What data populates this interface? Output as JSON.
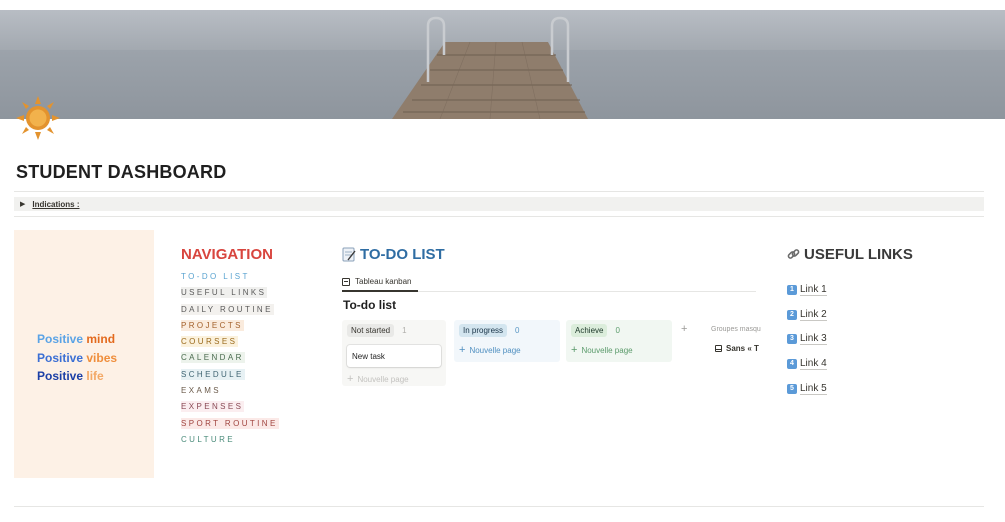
{
  "page": {
    "title": "STUDENT DASHBOARD",
    "page_icon": "sun-icon"
  },
  "toggle": {
    "label": "Indications :"
  },
  "vibes": [
    {
      "word": "Positive",
      "emphasis": "mind"
    },
    {
      "word": "Positive",
      "emphasis": "vibes"
    },
    {
      "word": "Positive",
      "emphasis": "life"
    }
  ],
  "navigation": {
    "title": "NAVIGATION",
    "items": [
      {
        "label": "TO-DO LIST",
        "color": "#5aa3d0",
        "bg": "transparent"
      },
      {
        "label": "USEFUL LINKS",
        "color": "#5a5a5a",
        "bg": "#f0f0ee"
      },
      {
        "label": "DAILY ROUTINE",
        "color": "#5a5a5a",
        "bg": "#f3f1ee"
      },
      {
        "label": "PROJECTS",
        "color": "#a3612c",
        "bg": "#faebdd"
      },
      {
        "label": "COURSES",
        "color": "#9a6a1c",
        "bg": "#fbf1dc"
      },
      {
        "label": "CALENDAR",
        "color": "#4a6b4f",
        "bg": "#edf3ec"
      },
      {
        "label": "SCHEDULE",
        "color": "#3f6472",
        "bg": "#e7f1f4"
      },
      {
        "label": "EXAMS",
        "color": "#6a5a4a",
        "bg": "transparent"
      },
      {
        "label": "EXPENSES",
        "color": "#8a4a55",
        "bg": "#fbeef0"
      },
      {
        "label": "SPORT ROUTINE",
        "color": "#a0443f",
        "bg": "#fbe9e7"
      },
      {
        "label": "CULTURE",
        "color": "#4a8b7a",
        "bg": "transparent"
      }
    ]
  },
  "todo": {
    "title": "TO-DO LIST",
    "view_tab": "Tableau kanban",
    "board_title": "To-do list",
    "columns": [
      {
        "label": "Not started",
        "count": "1",
        "card": "New task",
        "new_page": "Nouvelle page"
      },
      {
        "label": "In progress",
        "count": "0",
        "new_page": "Nouvelle page"
      },
      {
        "label": "Achieve",
        "count": "0",
        "new_page": "Nouvelle page"
      }
    ],
    "add_column": "+",
    "hidden_groups": "Groupes masqués",
    "hidden_item": "Sans « T"
  },
  "links": {
    "title": "USEFUL LINKS",
    "items": [
      {
        "key": "1",
        "label": "Link 1"
      },
      {
        "key": "2",
        "label": "Link 2"
      },
      {
        "key": "3",
        "label": "Link 3"
      },
      {
        "key": "4",
        "label": "Link 4"
      },
      {
        "key": "5",
        "label": "Link 5"
      }
    ]
  }
}
